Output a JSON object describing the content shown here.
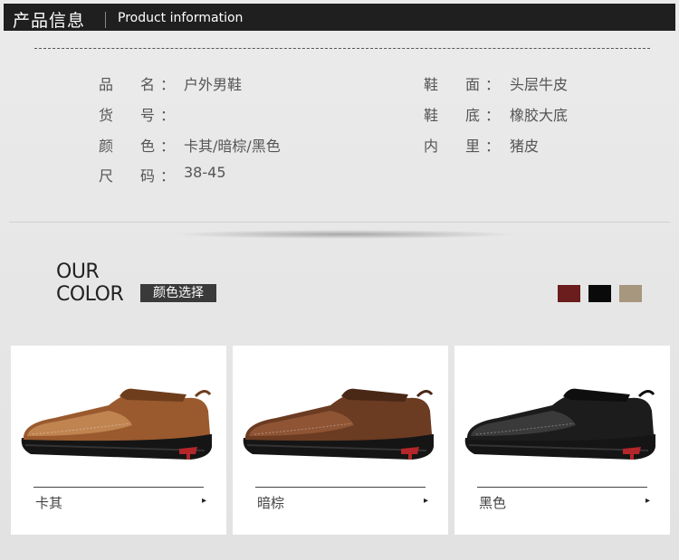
{
  "header": {
    "title_cn": "产品信息",
    "title_en": "Product information"
  },
  "info_left": [
    {
      "label": [
        "品",
        "名"
      ],
      "value": "户外男鞋"
    },
    {
      "label": [
        "货",
        "号"
      ],
      "value": ""
    },
    {
      "label": [
        "颜",
        "色"
      ],
      "value": "卡其/暗棕/黑色"
    },
    {
      "label": [
        "尺",
        "码"
      ],
      "value": "38-45"
    }
  ],
  "info_right": [
    {
      "label": [
        "鞋",
        "面"
      ],
      "value": "头层牛皮"
    },
    {
      "label": [
        "鞋",
        "底"
      ],
      "value": "橡胶大底"
    },
    {
      "label": [
        "内",
        "里"
      ],
      "value": "猪皮"
    }
  ],
  "colon": "：",
  "color_section": {
    "heading_line1": "OUR",
    "heading_line2": "COLOR",
    "tag": "颜色选择",
    "swatches": [
      "#6b1c1c",
      "#0a0a0a",
      "#a8977f"
    ]
  },
  "cards": [
    {
      "name": "卡其",
      "arrow": "▸",
      "upper": "#9a5a2e",
      "upper_light": "#c08450",
      "collar": "#6e3e1c"
    },
    {
      "name": "暗棕",
      "arrow": "▸",
      "upper": "#6b3b22",
      "upper_light": "#8e5434",
      "collar": "#4a2816"
    },
    {
      "name": "黑色",
      "arrow": "▸",
      "upper": "#1c1c1c",
      "upper_light": "#3a3a3a",
      "collar": "#0e0e0e"
    }
  ]
}
